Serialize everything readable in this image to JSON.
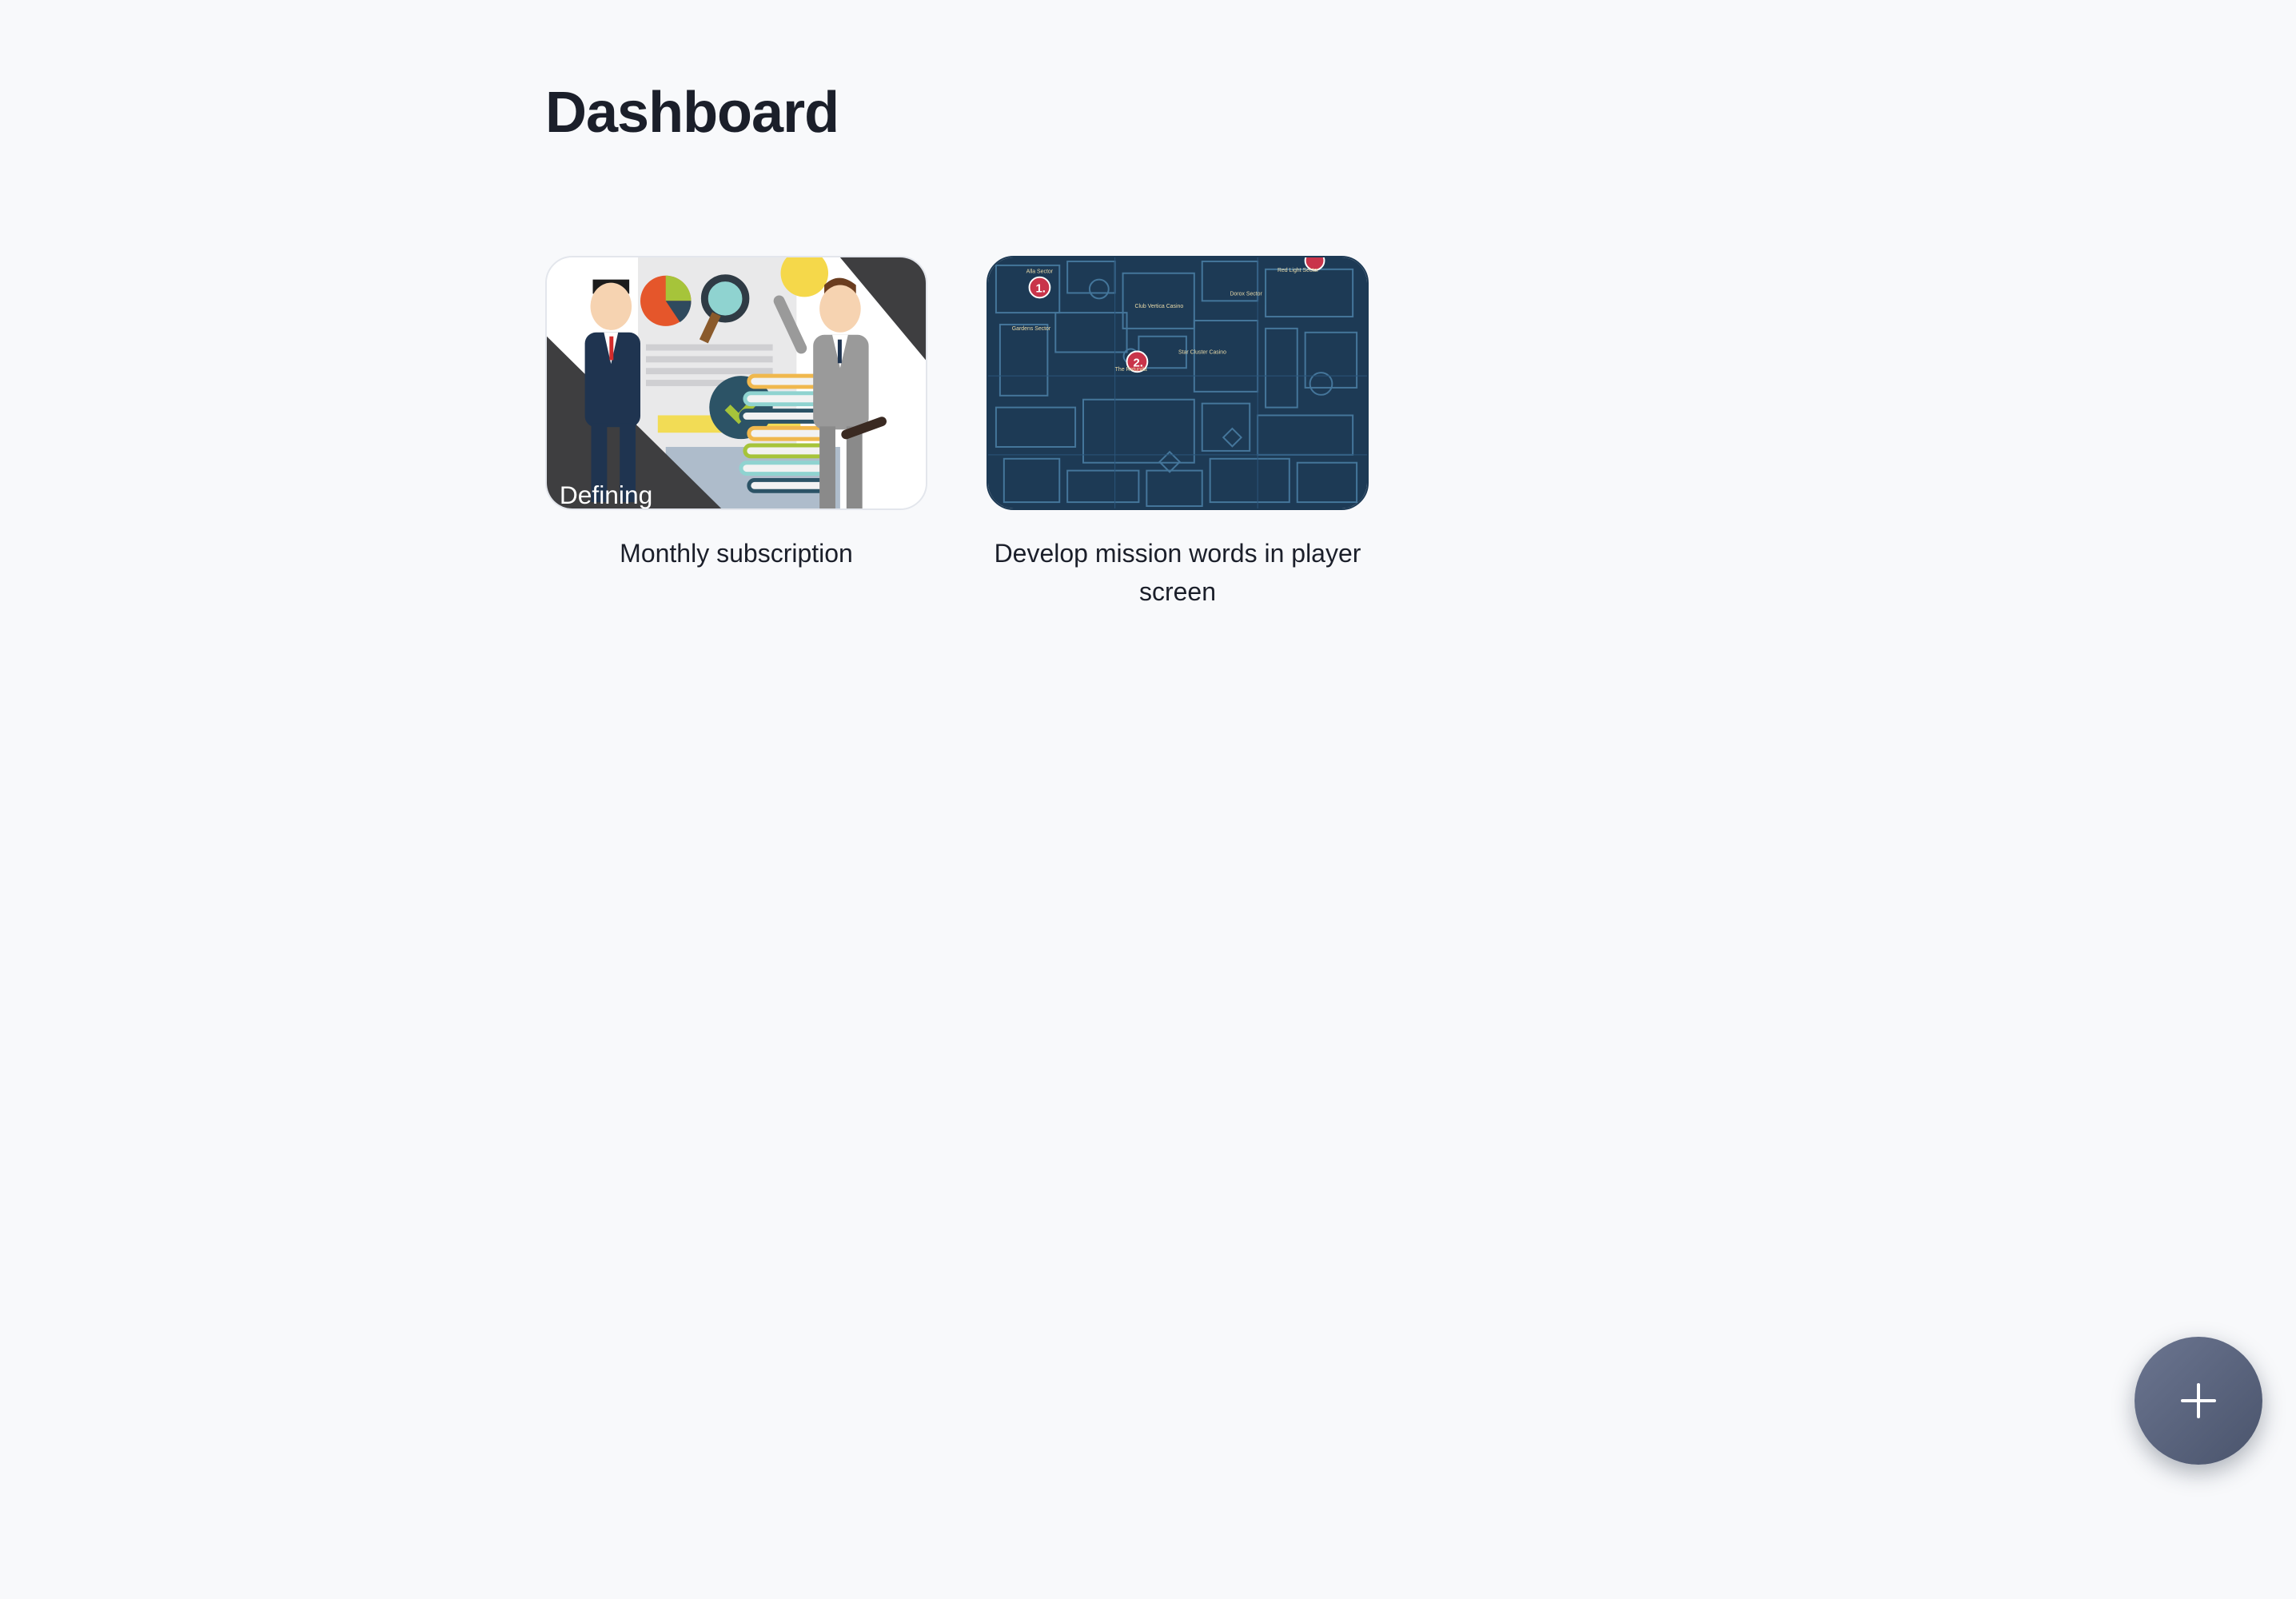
{
  "page": {
    "title": "Dashboard"
  },
  "cards": [
    {
      "caption": "Monthly subscription",
      "thumbnail_overlay_text": "Defining",
      "thumbnail_icon": "business-people-illustration"
    },
    {
      "caption": "Develop mission words in player screen",
      "thumbnail_icon": "game-map-illustration"
    }
  ],
  "fab": {
    "icon": "plus-icon"
  },
  "colors": {
    "background": "#f8f9fb",
    "text": "#1b1f2a",
    "fab": "#5c667e",
    "map": "#1d3a55"
  }
}
